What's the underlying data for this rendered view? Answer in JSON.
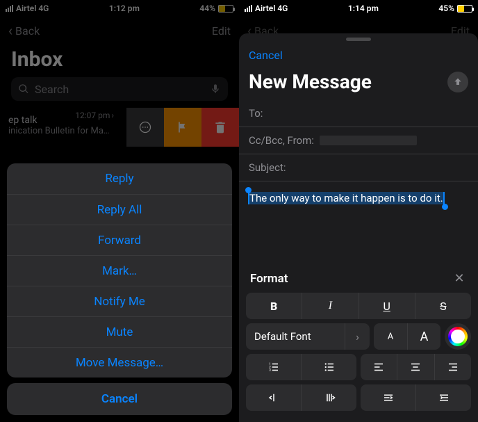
{
  "left": {
    "status": {
      "carrier": "Airtel 4G",
      "time": "1:12 pm",
      "battery_text": "44%",
      "battery_pct": 44
    },
    "nav": {
      "back": "Back",
      "edit": "Edit"
    },
    "title": "Inbox",
    "search_placeholder": "Search",
    "message": {
      "time": "12:07 pm",
      "line1": "ep talk",
      "line2": "inication Bulletin for Ma…"
    },
    "sheet": {
      "items": [
        "Reply",
        "Reply All",
        "Forward",
        "Mark…",
        "Notify Me",
        "Mute",
        "Move Message…"
      ],
      "cancel": "Cancel"
    }
  },
  "right": {
    "status": {
      "carrier": "Airtel 4G",
      "time": "1:14 pm",
      "battery_text": "45%",
      "battery_pct": 45
    },
    "nav_back": "Back",
    "nav_edit": "Edit",
    "cancel": "Cancel",
    "title": "New Message",
    "fields": {
      "to_label": "To:",
      "cc_label": "Cc/Bcc, From:",
      "subject_label": "Subject:"
    },
    "body_selected": "The only way to make it happen is to do it.",
    "format": {
      "title": "Format",
      "bold": "B",
      "italic": "I",
      "underline": "U",
      "strike": "S",
      "font_label": "Default Font",
      "size_small": "A",
      "size_large": "A"
    }
  }
}
